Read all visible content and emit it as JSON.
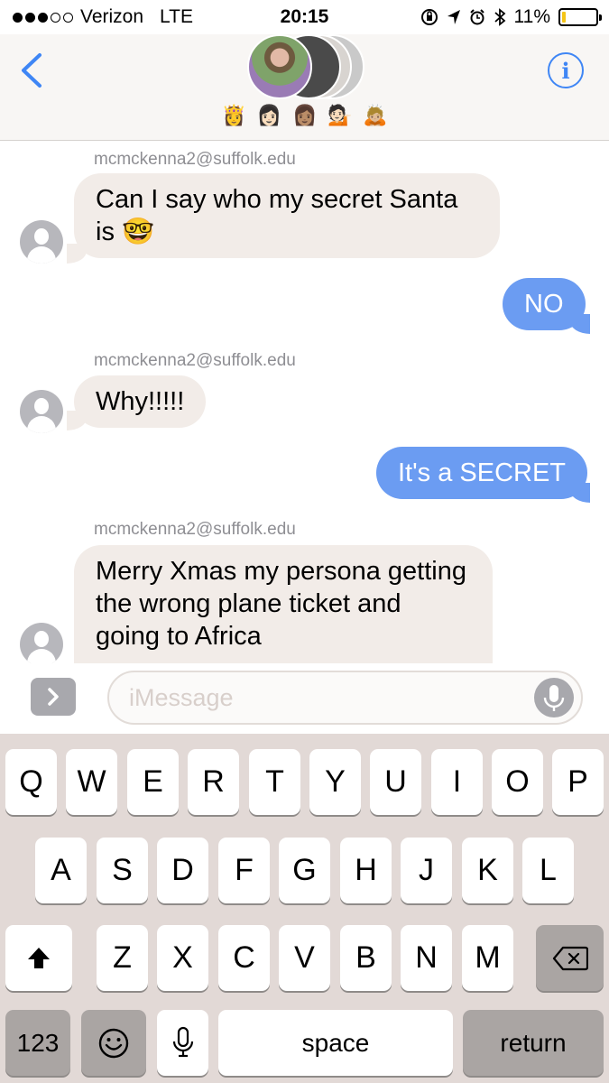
{
  "status_bar": {
    "carrier": "Verizon",
    "network": "LTE",
    "time": "20:15",
    "battery": "11%",
    "battery_level": 0.11,
    "signal_bars": 3
  },
  "header": {
    "back_icon": "chevron-left-icon",
    "info_label": "i",
    "participant_emojis": [
      "👸",
      "👩🏻",
      "👩🏽",
      "💁🏻",
      "🙇🏼"
    ]
  },
  "messages": [
    {
      "direction": "in",
      "sender": "mcmckenna2@suffolk.edu",
      "text": "Can I say who my secret Santa is 🤓"
    },
    {
      "direction": "out",
      "text": "NO"
    },
    {
      "direction": "in",
      "sender": "mcmckenna2@suffolk.edu",
      "text": "Why!!!!!"
    },
    {
      "direction": "out",
      "text": "It's a SECRET"
    },
    {
      "direction": "in",
      "sender": "mcmckenna2@suffolk.edu",
      "text": "Merry Xmas my persona getting the wrong plane ticket and going to Africa"
    }
  ],
  "input": {
    "placeholder": "iMessage",
    "value": "",
    "expand_icon": "chevron-right-icon",
    "mic_icon": "microphone-icon"
  },
  "keyboard": {
    "row1": [
      "Q",
      "W",
      "E",
      "R",
      "T",
      "Y",
      "U",
      "I",
      "O",
      "P"
    ],
    "row2": [
      "A",
      "S",
      "D",
      "F",
      "G",
      "H",
      "J",
      "K",
      "L"
    ],
    "row3": [
      "Z",
      "X",
      "C",
      "V",
      "B",
      "N",
      "M"
    ],
    "numbers_label": "123",
    "space_label": "space",
    "return_label": "return"
  },
  "colors": {
    "outgoing_bubble": "#6b9cf2",
    "incoming_bubble": "#f2ece8",
    "accent": "#3f86f5",
    "battery_fill": "#f5c518"
  }
}
